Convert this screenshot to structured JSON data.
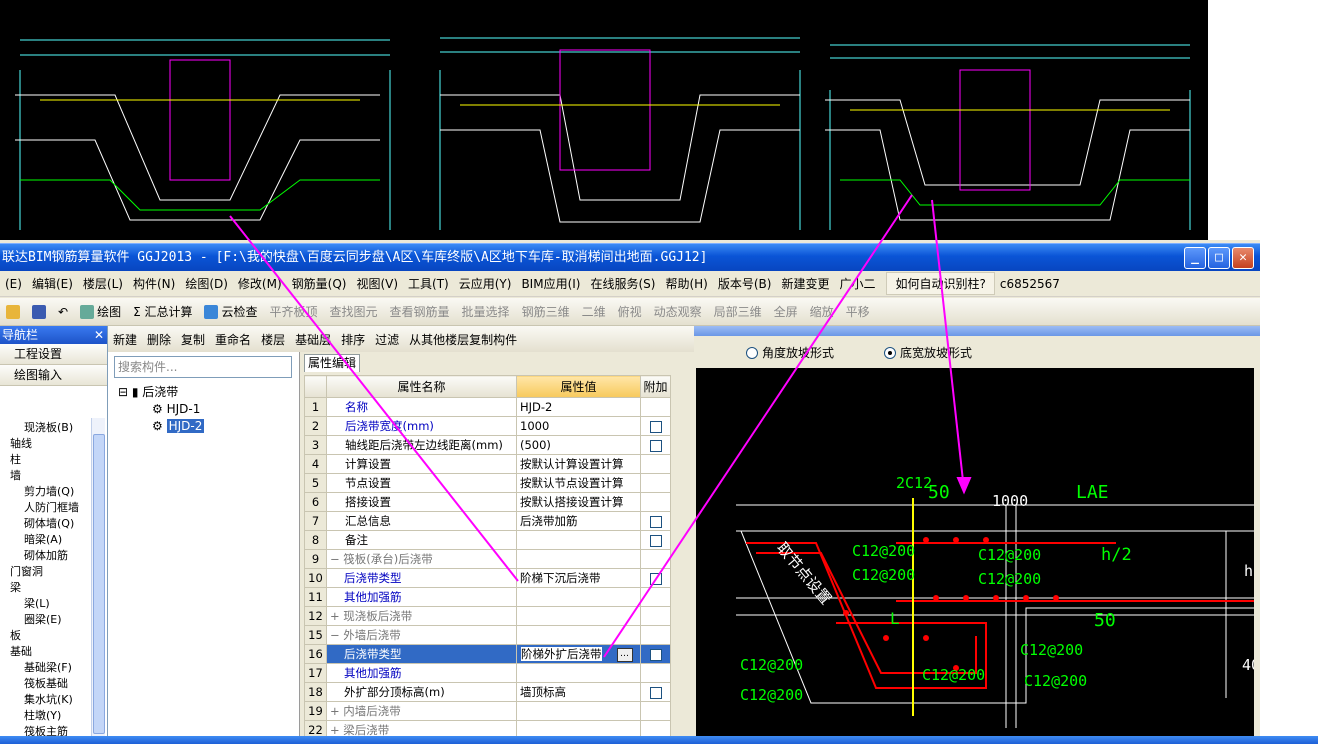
{
  "window": {
    "title": "联达BIM钢筋算量软件 GGJ2013 - [F:\\我的快盘\\百度云同步盘\\A区\\车库终版\\A区地下车库-取消梯间出地面.GGJ12]",
    "min": "_",
    "max": "□",
    "close": "✕"
  },
  "menu": [
    "(E)",
    "编辑(E)",
    "楼层(L)",
    "构件(N)",
    "绘图(D)",
    "修改(M)",
    "钢筋量(Q)",
    "视图(V)",
    "工具(T)",
    "云应用(Y)",
    "BIM应用(I)",
    "在线服务(S)",
    "帮助(H)",
    "版本号(B)",
    "新建变更",
    "广小二",
    "如何自动识别柱?",
    "c6852567"
  ],
  "toolbar1": [
    "绘图",
    "Σ 汇总计算",
    "云检查",
    "平齐板顶",
    "查找图元",
    "查看钢筋量",
    "批量选择",
    "钢筋三维",
    "二维",
    "俯视",
    "动态观察",
    "局部三维",
    "全屏",
    "缩放",
    "平移"
  ],
  "toolbar2": [
    "新建",
    "删除",
    "复制",
    "重命名",
    "楼层",
    "基础层",
    "排序",
    "过滤",
    "从其他楼层复制构件"
  ],
  "nav": {
    "title": "导航栏",
    "close": "✕",
    "buttons": [
      "工程设置",
      "绘图输入"
    ],
    "items": [
      "现浇板(B)",
      "轴线",
      "柱",
      "墙",
      "剪力墙(Q)",
      "人防门框墙",
      "砌体墙(Q)",
      "暗梁(A)",
      "砌体加筋",
      "门窗洞",
      "梁",
      "梁(L)",
      "圈梁(E)",
      "板",
      "基础",
      "基础梁(F)",
      "筏板基础",
      "集水坑(K)",
      "柱墩(Y)",
      "筏板主筋"
    ]
  },
  "components": {
    "search_placeholder": "搜索构件...",
    "root": "后浇带",
    "children": [
      "HJD-1",
      "HJD-2"
    ]
  },
  "props": {
    "tab": "属性编辑",
    "headers": [
      "属性名称",
      "属性值",
      "附加"
    ],
    "rows": [
      {
        "n": "1",
        "name": "名称",
        "val": "HJD-2",
        "chk": false,
        "style": "blue"
      },
      {
        "n": "2",
        "name": "后浇带宽度(mm)",
        "val": "1000",
        "chk": true,
        "style": "blue"
      },
      {
        "n": "3",
        "name": "轴线距后浇带左边线距离(mm)",
        "val": "(500)",
        "chk": true,
        "style": ""
      },
      {
        "n": "4",
        "name": "计算设置",
        "val": "按默认计算设置计算",
        "chk": false,
        "style": ""
      },
      {
        "n": "5",
        "name": "节点设置",
        "val": "按默认节点设置计算",
        "chk": false,
        "style": ""
      },
      {
        "n": "6",
        "name": "搭接设置",
        "val": "按默认搭接设置计算",
        "chk": false,
        "style": ""
      },
      {
        "n": "7",
        "name": "汇总信息",
        "val": "后浇带加筋",
        "chk": true,
        "style": ""
      },
      {
        "n": "8",
        "name": "备注",
        "val": "",
        "chk": true,
        "style": ""
      },
      {
        "n": "9",
        "name": "筏板(承台)后浇带",
        "val": "",
        "chk": false,
        "style": "grey",
        "exp": "−"
      },
      {
        "n": "10",
        "name": "后浇带类型",
        "val": "阶梯下沉后浇带",
        "chk": true,
        "style": "blue",
        "indent": true
      },
      {
        "n": "11",
        "name": "其他加强筋",
        "val": "",
        "chk": false,
        "style": "blue",
        "indent": true
      },
      {
        "n": "12",
        "name": "现浇板后浇带",
        "val": "",
        "chk": false,
        "style": "grey",
        "exp": "+"
      },
      {
        "n": "15",
        "name": "外墙后浇带",
        "val": "",
        "chk": false,
        "style": "grey",
        "exp": "−"
      },
      {
        "n": "16",
        "name": "后浇带类型",
        "val": "阶梯外扩后浇带",
        "chk": true,
        "style": "sel",
        "indent": true
      },
      {
        "n": "17",
        "name": "其他加强筋",
        "val": "",
        "chk": false,
        "style": "blue",
        "indent": true
      },
      {
        "n": "18",
        "name": "外扩部分顶标高(m)",
        "val": "墙顶标高",
        "chk": true,
        "style": "",
        "indent": true
      },
      {
        "n": "19",
        "name": "内墙后浇带",
        "val": "",
        "chk": false,
        "style": "grey",
        "exp": "+"
      },
      {
        "n": "22",
        "name": "梁后浇带",
        "val": "",
        "chk": false,
        "style": "grey",
        "exp": "+"
      }
    ]
  },
  "param": {
    "radio1": "角度放坡形式",
    "radio2": "底宽放坡形式",
    "labels": {
      "top": "2C12",
      "d50a": "50",
      "d1000": "1000",
      "lae": "LAE",
      "h2": "h/2",
      "c1": "C12@200",
      "c2": "C12@200",
      "c3": "C12@200",
      "c4": "C12@200",
      "c5": "C12@200",
      "c6": "C12@200",
      "c7": "C12@200",
      "c8": "C12@200",
      "c9": "C12@200",
      "d50b": "50",
      "L": "L",
      "vert": "取节点设置",
      "h": "h",
      "v40": "40"
    }
  }
}
